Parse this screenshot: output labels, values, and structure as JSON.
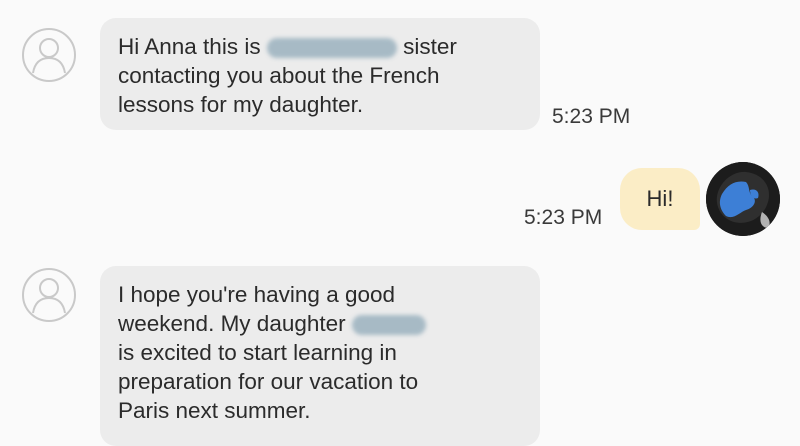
{
  "messages": [
    {
      "direction": "incoming",
      "lines": [
        "Hi Anna this is",
        "sister",
        "contacting you about the French",
        "lessons for my daughter."
      ],
      "time": "5:23 PM"
    },
    {
      "direction": "outgoing",
      "text": "Hi!",
      "time": "5:23 PM"
    },
    {
      "direction": "incoming",
      "lines": [
        "I hope you're having a good",
        "weekend. My daughter",
        "is excited to start learning  in",
        "preparation for our vacation to",
        "Paris next summer."
      ]
    }
  ],
  "icons": {
    "contact_avatar": "person-outline-icon",
    "user_avatar": "profile-photo"
  },
  "colors": {
    "incoming_bubble": "#ececec",
    "outgoing_bubble": "#fbedc6",
    "background": "#fafafa",
    "redaction": "#9bb2bf"
  }
}
